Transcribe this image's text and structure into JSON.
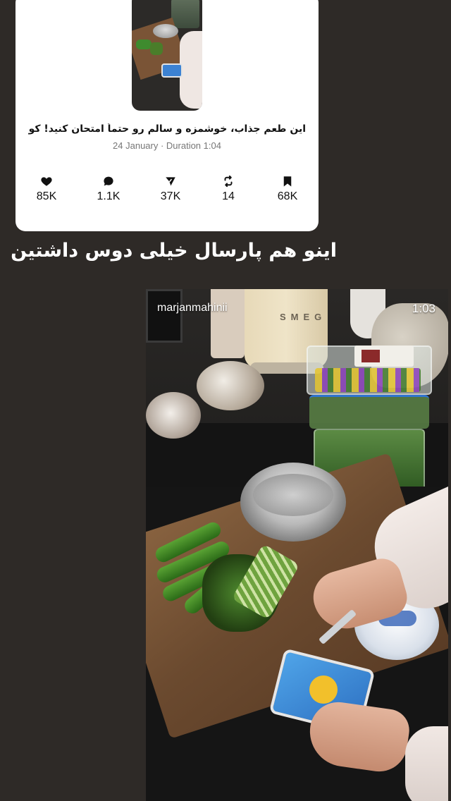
{
  "post_card": {
    "title": "این طعم جذاب، خوشمزه و سالم رو حتماً امتحان کنید! کو...",
    "meta": "24 January · Duration 1:04",
    "stats": {
      "likes": "85K",
      "comments": "1.1K",
      "shares": "37K",
      "reposts": "14",
      "saves": "68K"
    },
    "icons": {
      "likes": "heart-icon",
      "comments": "comment-icon",
      "shares": "send-icon",
      "reposts": "repost-icon",
      "saves": "bookmark-icon"
    }
  },
  "caption": "اینو هم پارسال خیلی دوس داشتین",
  "video": {
    "username": "marjanmahinii",
    "timestamp": "1:03"
  }
}
